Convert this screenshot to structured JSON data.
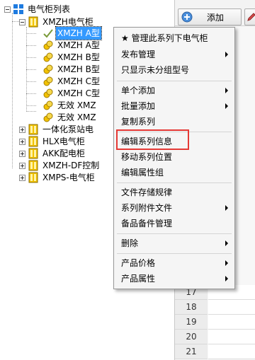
{
  "tree": {
    "root": "电气柜列表",
    "group_xmzh": "XMZH电气柜",
    "children": [
      "XMZH A型",
      "XMZH A型",
      "XMZH B型",
      "XMZH B型",
      "XMZH C型",
      "XMZH C型",
      "无效 XMZ",
      "无效 XMZ"
    ],
    "groups": [
      "一体化泵站电",
      "HLX电气柜",
      "AKK配电柜",
      "XMZH-DF控制",
      "XMPS-电气柜"
    ]
  },
  "toolbar": {
    "add_label": "添加"
  },
  "grid": {
    "row_numbers": [
      "17",
      "18",
      "19",
      "20",
      "21"
    ]
  },
  "context_menu": {
    "items": [
      {
        "label": "★ 管理此系列下电气柜",
        "submenu": false
      },
      {
        "label": "发布管理",
        "submenu": true
      },
      {
        "label": "只显示未分组型号",
        "submenu": false
      },
      {
        "label": "单个添加",
        "submenu": true
      },
      {
        "label": "批量添加",
        "submenu": true
      },
      {
        "label": "复制系列",
        "submenu": false
      },
      {
        "label": "编辑系列信息",
        "submenu": false
      },
      {
        "label": "移动系列位置",
        "submenu": false
      },
      {
        "label": "编辑属性组",
        "submenu": false
      },
      {
        "label": "文件存储规律",
        "submenu": false
      },
      {
        "label": "系列附件文件",
        "submenu": true
      },
      {
        "label": "备品备件管理",
        "submenu": false
      },
      {
        "label": "删除",
        "submenu": true
      },
      {
        "label": "产品价格",
        "submenu": true
      },
      {
        "label": "产品属性",
        "submenu": true
      }
    ]
  },
  "colors": {
    "selection": "#3399ff",
    "highlight_box": "#e53935",
    "cabinet_icon": "#f2c200",
    "root_icon": "#1e7be0"
  }
}
